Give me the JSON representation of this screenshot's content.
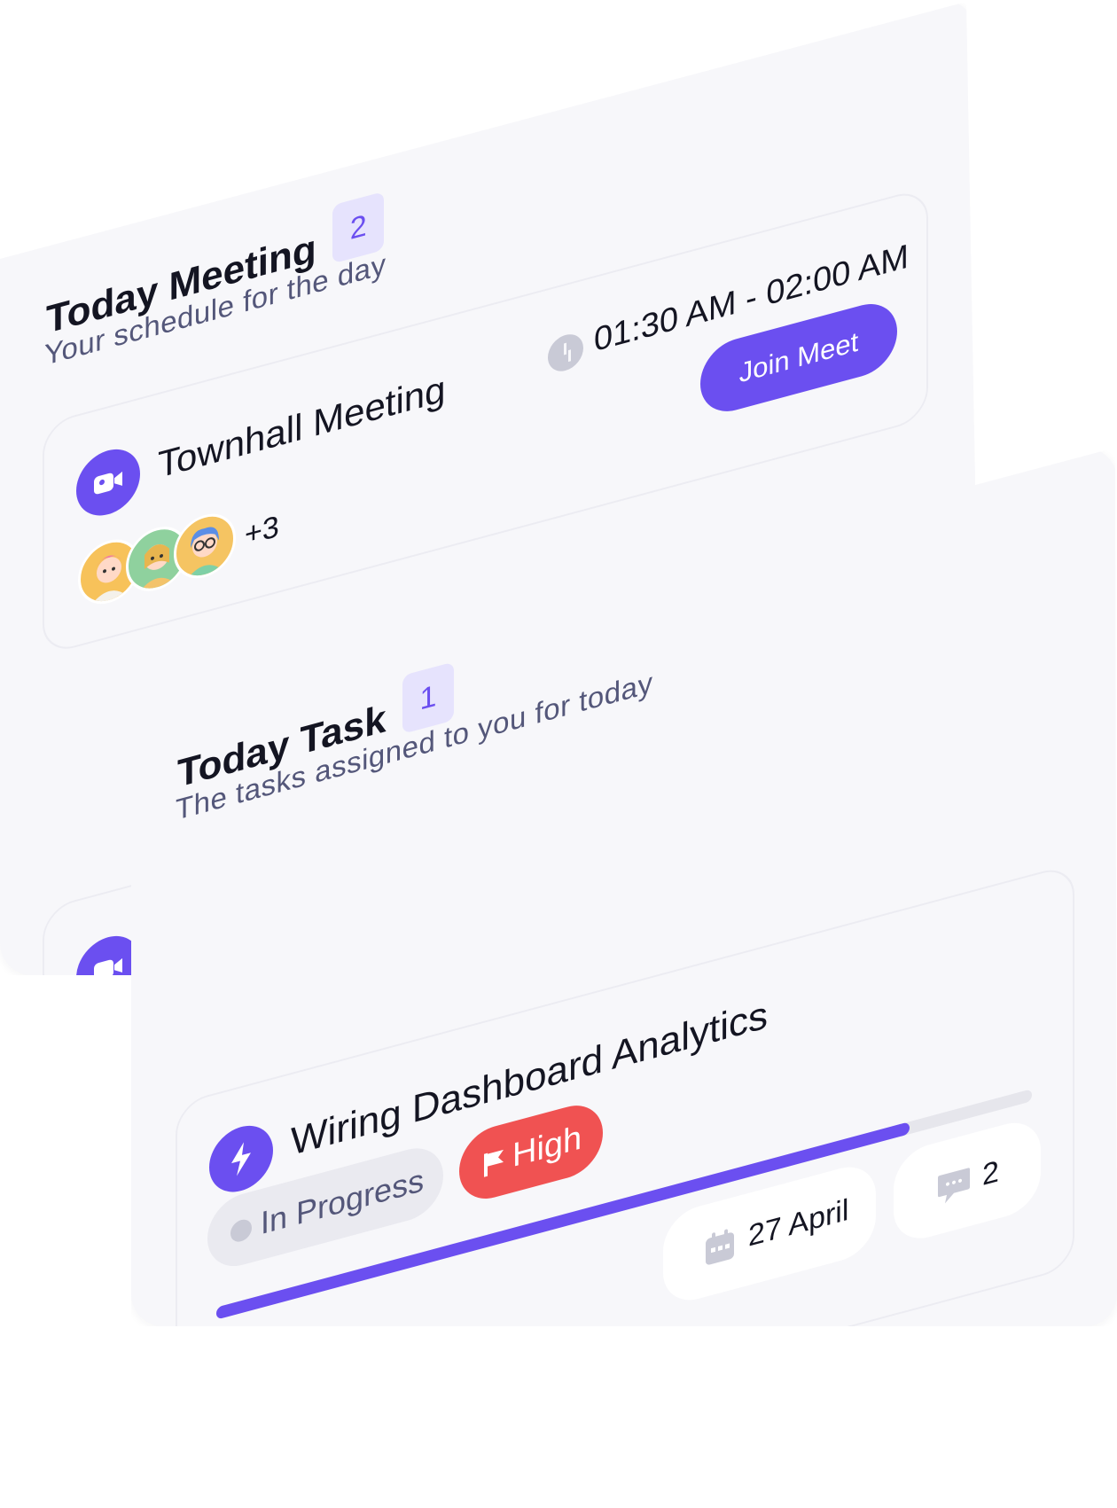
{
  "meeting_panel": {
    "title": "Today Meeting",
    "count": "2",
    "subtitle": "Your schedule for the day",
    "meeting": {
      "title": "Townhall Meeting",
      "time": "01:30 AM - 02:00 AM",
      "join_label": "Join Meet",
      "extra_attendees": "+3"
    }
  },
  "task_panel": {
    "title": "Today Task",
    "count": "1",
    "subtitle": "The tasks assigned to you for today",
    "task": {
      "title": "Wiring Dashboard Analytics",
      "status": "In Progress",
      "priority": "High",
      "progress_fraction": 0.85,
      "due_date": "27 April",
      "comments": "2"
    }
  },
  "colors": {
    "accent": "#6b4ff0",
    "priority_high": "#f05252",
    "badge_bg": "#e6e3fd"
  }
}
